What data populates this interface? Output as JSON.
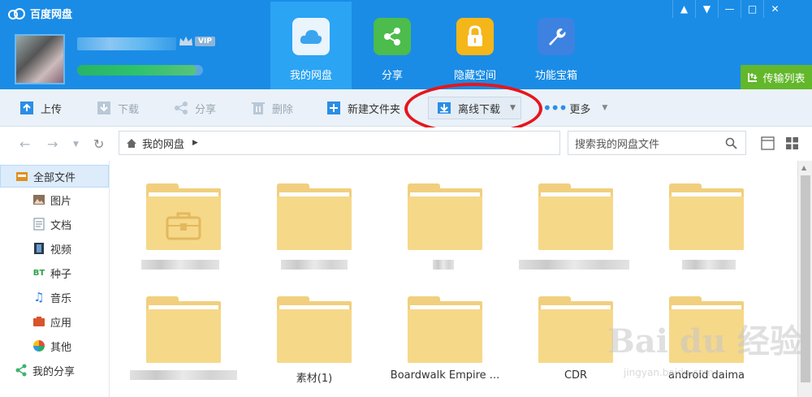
{
  "app": {
    "title": "百度网盘"
  },
  "user": {
    "vip_label": "VIP",
    "quota_fraction": 0.95
  },
  "nav_tabs": [
    {
      "label": "我的网盘",
      "icon": "cloud-icon"
    },
    {
      "label": "分享",
      "icon": "share-icon"
    },
    {
      "label": "隐藏空间",
      "icon": "lock-icon"
    },
    {
      "label": "功能宝箱",
      "icon": "wrench-icon"
    }
  ],
  "window_controls": [
    "bell-icon",
    "menu-icon",
    "minimize-icon",
    "maximize-icon",
    "close-icon"
  ],
  "transfer_label": "传输列表",
  "toolbar": {
    "upload": "上传",
    "download": "下载",
    "share": "分享",
    "delete": "删除",
    "new_folder": "新建文件夹",
    "offline_download": "离线下载",
    "more": "更多"
  },
  "address": {
    "crumb": "我的网盘",
    "search_placeholder": "搜索我的网盘文件"
  },
  "sidebar": {
    "items": [
      {
        "label": "全部文件",
        "icon": "all-files-icon"
      },
      {
        "label": "图片",
        "icon": "image-icon"
      },
      {
        "label": "文档",
        "icon": "document-icon"
      },
      {
        "label": "视频",
        "icon": "video-icon"
      },
      {
        "label": "种子",
        "icon": "bt-icon"
      },
      {
        "label": "音乐",
        "icon": "music-icon"
      },
      {
        "label": "应用",
        "icon": "app-icon"
      },
      {
        "label": "其他",
        "icon": "other-icon"
      },
      {
        "label": "我的分享",
        "icon": "share-icon"
      }
    ],
    "bt_text": "BT"
  },
  "files": {
    "row2": [
      "素材(1)",
      "Boardwalk Empire ...",
      "CDR",
      "android daima"
    ]
  },
  "watermark": {
    "brand": "Bai du 经验",
    "url": "jingyan.baidu.com"
  },
  "colors": {
    "header": "#1a8ce6",
    "active_tab": "#2ba4f4",
    "transfer": "#62b72b",
    "folder": "#f6d889",
    "highlight": "#e5161d"
  }
}
